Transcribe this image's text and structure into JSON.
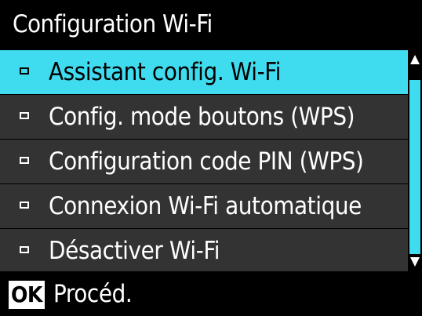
{
  "header": {
    "title": "Configuration Wi-Fi"
  },
  "menu": {
    "items": [
      {
        "label": "Assistant config. Wi-Fi",
        "selected": true
      },
      {
        "label": "Config. mode boutons (WPS)",
        "selected": false
      },
      {
        "label": "Configuration code PIN (WPS)",
        "selected": false
      },
      {
        "label": "Connexion Wi-Fi automatique",
        "selected": false
      },
      {
        "label": "Désactiver Wi-Fi",
        "selected": false
      }
    ]
  },
  "footer": {
    "ok_label": "OK",
    "action_label": "Procéd."
  },
  "colors": {
    "accent": "#3fdcef",
    "item_background": "#333333",
    "background": "#000000"
  },
  "icons": {
    "bullet": "square-bullet-icon",
    "scroll_up": "scroll-up-arrow-icon",
    "scroll_down": "scroll-down-arrow-icon"
  }
}
